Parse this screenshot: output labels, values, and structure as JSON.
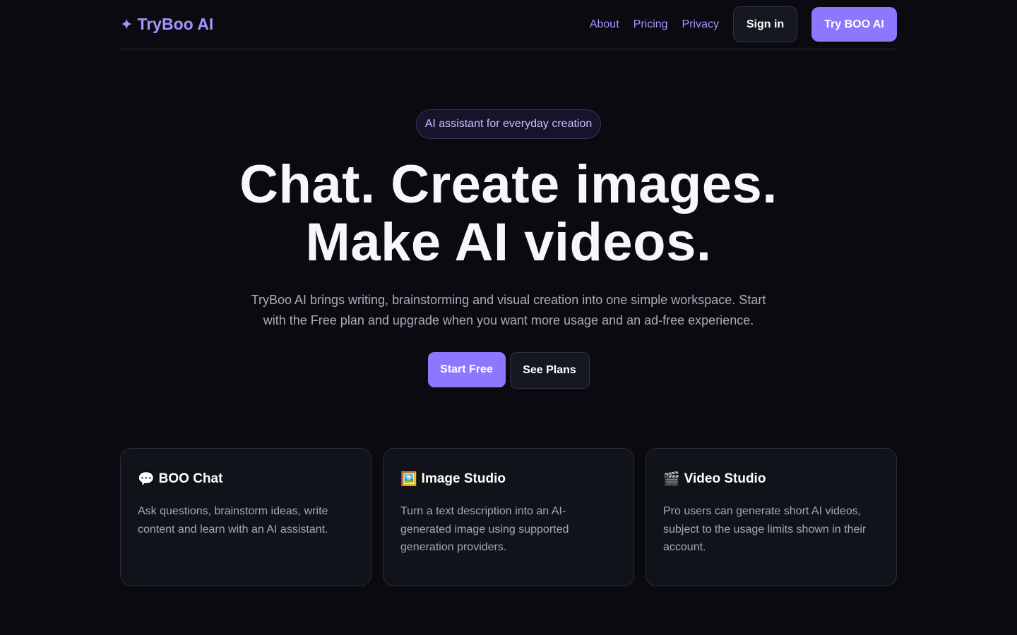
{
  "nav": {
    "brand_icon": "✦",
    "brand_name": "TryBoo AI",
    "links": [
      "About",
      "Pricing",
      "Privacy"
    ],
    "signin_label": "Sign in",
    "try_label": "Try BOO AI"
  },
  "hero": {
    "pill": "AI assistant for everyday creation",
    "headline_line1": "Chat. Create images.",
    "headline_line2": "Make AI videos.",
    "subtext": "TryBoo AI brings writing, brainstorming and visual creation into one simple workspace. Start with the Free plan and upgrade when you want more usage and an ad-free experience.",
    "start_label": "Start Free",
    "plans_label": "See Plans"
  },
  "cards": [
    {
      "icon": "💬",
      "title": "BOO Chat",
      "desc": "Ask questions, brainstorm ideas, write content and learn with an AI assistant."
    },
    {
      "icon": "🖼️",
      "title": "Image Studio",
      "desc": "Turn a text description into an AI-generated image using supported generation providers."
    },
    {
      "icon": "🎬",
      "title": "Video Studio",
      "desc": "Pro users can generate short AI videos, subject to the usage limits shown in their account."
    }
  ],
  "colors": {
    "background": "#0a0a10",
    "accent": "#8b78ff",
    "accent_text": "#a395ff",
    "card_bg": "#10131a"
  }
}
